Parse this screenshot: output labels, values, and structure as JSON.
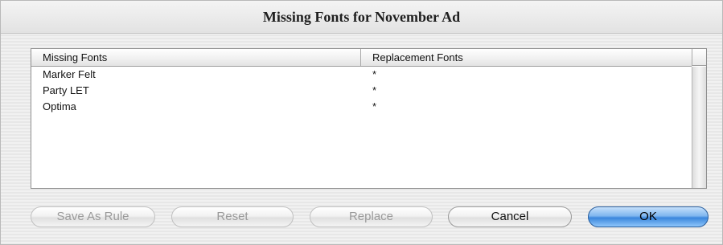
{
  "window": {
    "title": "Missing Fonts for November Ad"
  },
  "table": {
    "columns": [
      "Missing Fonts",
      "Replacement Fonts"
    ],
    "rows": [
      {
        "missing": "Marker Felt",
        "replacement": "*"
      },
      {
        "missing": "Party LET",
        "replacement": "*"
      },
      {
        "missing": "Optima",
        "replacement": "*"
      }
    ]
  },
  "buttons": {
    "save_as_rule": "Save As Rule",
    "reset": "Reset",
    "replace": "Replace",
    "cancel": "Cancel",
    "ok": "OK"
  },
  "colors": {
    "default_button": "#3b86dc",
    "disabled_text": "#9a9a9a"
  }
}
